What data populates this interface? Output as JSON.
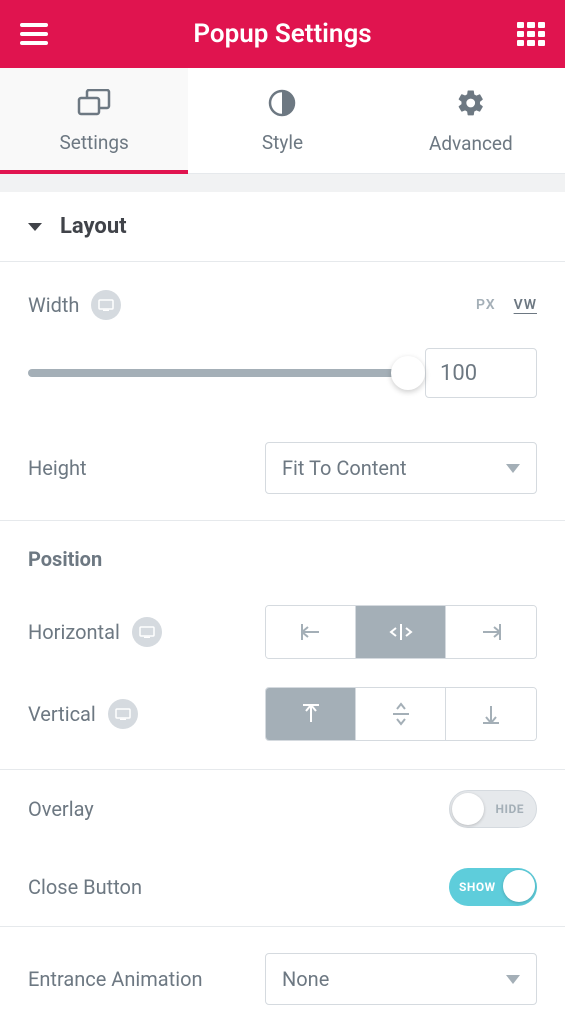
{
  "header": {
    "title": "Popup Settings"
  },
  "tabs": {
    "settings": "Settings",
    "style": "Style",
    "advanced": "Advanced"
  },
  "section": {
    "layout": "Layout"
  },
  "width": {
    "label": "Width",
    "value": "100",
    "units": {
      "px": "PX",
      "vw": "VW"
    }
  },
  "height": {
    "label": "Height",
    "value": "Fit To Content"
  },
  "position": {
    "title": "Position",
    "horizontal_label": "Horizontal",
    "vertical_label": "Vertical"
  },
  "overlay": {
    "label": "Overlay",
    "state_text": "HIDE"
  },
  "close_button": {
    "label": "Close Button",
    "state_text": "SHOW"
  },
  "entrance_animation": {
    "label": "Entrance Animation",
    "value": "None"
  }
}
